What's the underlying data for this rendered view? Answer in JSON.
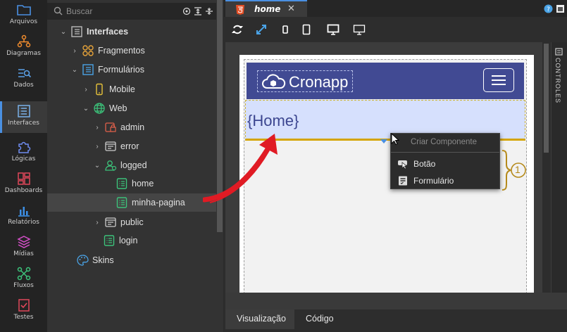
{
  "activity_bar": {
    "items": [
      {
        "label": "Arquivos",
        "icon": "folder-icon"
      },
      {
        "label": "Diagramas",
        "icon": "diagram-icon"
      },
      {
        "label": "Dados",
        "icon": "data-icon"
      },
      {
        "label": "Interfaces",
        "icon": "interface-icon"
      },
      {
        "label": "Lógicas",
        "icon": "puzzle-icon"
      },
      {
        "label": "Dashboards",
        "icon": "dashboard-icon"
      },
      {
        "label": "Relatórios",
        "icon": "report-icon"
      },
      {
        "label": "Mídias",
        "icon": "layers-icon"
      },
      {
        "label": "Fluxos",
        "icon": "flow-icon"
      },
      {
        "label": "Testes",
        "icon": "test-icon"
      }
    ]
  },
  "explorer": {
    "search_placeholder": "Buscar",
    "tree": [
      {
        "label": "Interfaces",
        "chevron": "v",
        "icon": "interface-icon"
      },
      {
        "label": "Fragmentos",
        "chevron": ">",
        "icon": "fragment-icon"
      },
      {
        "label": "Formulários",
        "chevron": "v",
        "icon": "form-icon"
      },
      {
        "label": "Mobile",
        "chevron": ">",
        "icon": "mobile-icon"
      },
      {
        "label": "Web",
        "chevron": "v",
        "icon": "globe-icon"
      },
      {
        "label": "admin",
        "chevron": ">",
        "icon": "lock-page-icon"
      },
      {
        "label": "error",
        "chevron": ">",
        "icon": "page-icon"
      },
      {
        "label": "logged",
        "chevron": "v",
        "icon": "user-page-icon"
      },
      {
        "label": "home",
        "chevron": "",
        "icon": "html-file-icon"
      },
      {
        "label": "minha-pagina",
        "chevron": "",
        "icon": "html-file-icon"
      },
      {
        "label": "public",
        "chevron": ">",
        "icon": "page-icon"
      },
      {
        "label": "login",
        "chevron": "",
        "icon": "html-file-icon"
      },
      {
        "label": "Skins",
        "chevron": "",
        "icon": "palette-icon"
      }
    ]
  },
  "editor": {
    "tab_label": "home",
    "brand": "Cronapp",
    "home_text": "{Home}",
    "controls_label": "CONTROLES",
    "context_menu": {
      "title": "Criar Componente",
      "items": [
        "Botão",
        "Formulário"
      ]
    },
    "callout_number": "1",
    "bottom_tabs": [
      "Visualização",
      "Código"
    ]
  },
  "colors": {
    "accent": "#4a90e2",
    "navbar": "#414a93",
    "home_bg": "#d6e0fd",
    "arrow": "#e01b24",
    "callout": "#b58a1b"
  }
}
